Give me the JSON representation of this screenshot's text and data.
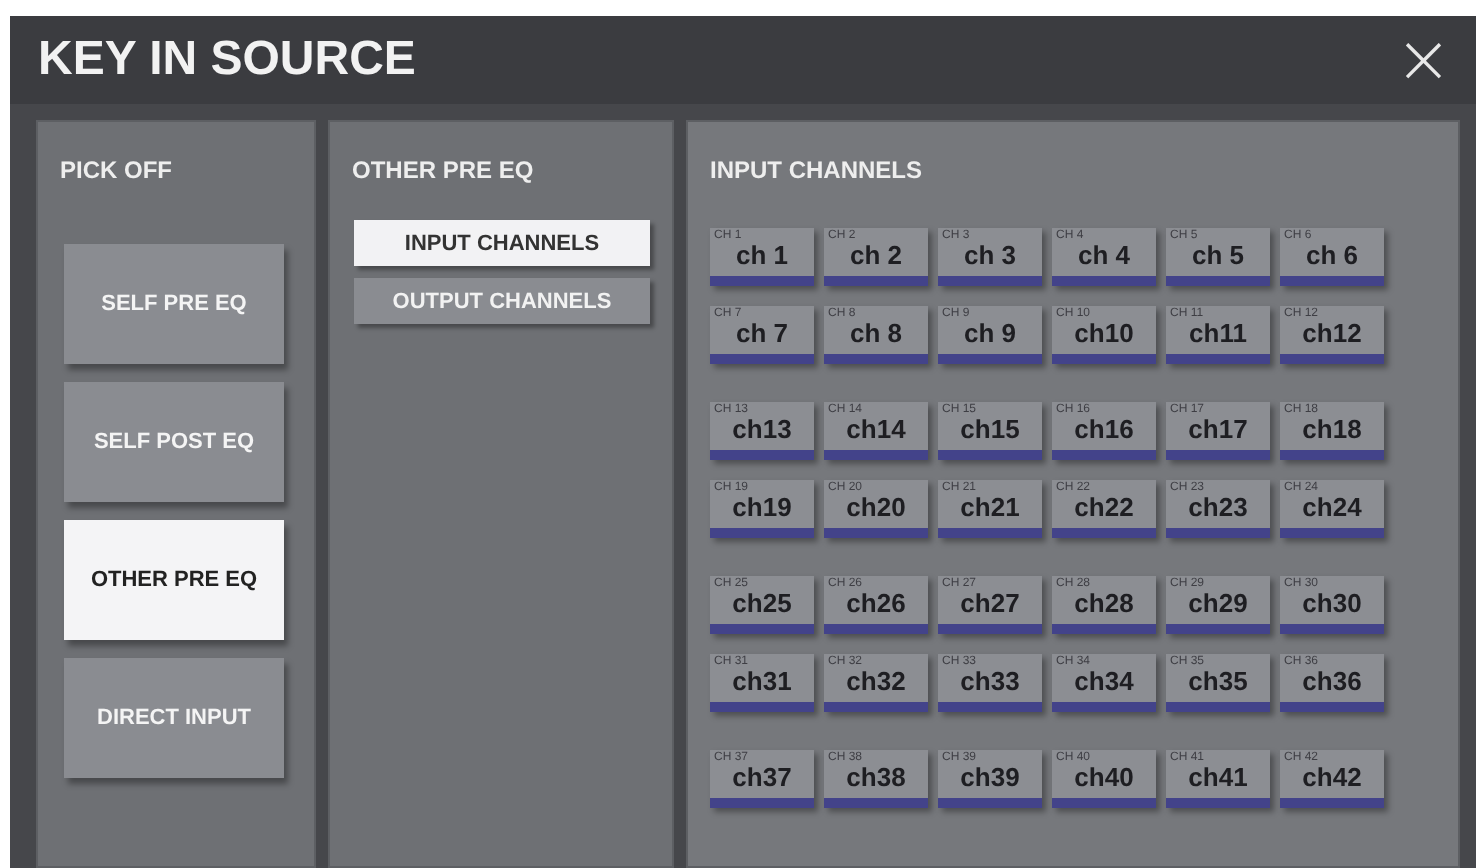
{
  "window": {
    "title": "KEY IN SOURCE",
    "close": "×"
  },
  "pick_off": {
    "title": "PICK OFF",
    "options": [
      {
        "label": "SELF PRE EQ",
        "selected": false
      },
      {
        "label": "SELF POST EQ",
        "selected": false
      },
      {
        "label": "OTHER PRE EQ",
        "selected": true
      },
      {
        "label": "DIRECT INPUT",
        "selected": false
      }
    ]
  },
  "source_type": {
    "title": "OTHER PRE EQ",
    "options": [
      {
        "label": "INPUT CHANNELS",
        "selected": true
      },
      {
        "label": "OUTPUT CHANNELS",
        "selected": false
      }
    ]
  },
  "channels_panel": {
    "title": "INPUT CHANNELS",
    "channels": [
      {
        "number": "CH 1",
        "name": "ch 1"
      },
      {
        "number": "CH 2",
        "name": "ch 2"
      },
      {
        "number": "CH 3",
        "name": "ch 3"
      },
      {
        "number": "CH 4",
        "name": "ch 4"
      },
      {
        "number": "CH 5",
        "name": "ch 5"
      },
      {
        "number": "CH 6",
        "name": "ch 6"
      },
      {
        "number": "CH 7",
        "name": "ch 7"
      },
      {
        "number": "CH 8",
        "name": "ch 8"
      },
      {
        "number": "CH 9",
        "name": "ch 9"
      },
      {
        "number": "CH 10",
        "name": "ch10"
      },
      {
        "number": "CH 11",
        "name": "ch11"
      },
      {
        "number": "CH 12",
        "name": "ch12"
      },
      {
        "number": "CH 13",
        "name": "ch13"
      },
      {
        "number": "CH 14",
        "name": "ch14"
      },
      {
        "number": "CH 15",
        "name": "ch15"
      },
      {
        "number": "CH 16",
        "name": "ch16"
      },
      {
        "number": "CH 17",
        "name": "ch17"
      },
      {
        "number": "CH 18",
        "name": "ch18"
      },
      {
        "number": "CH 19",
        "name": "ch19"
      },
      {
        "number": "CH 20",
        "name": "ch20"
      },
      {
        "number": "CH 21",
        "name": "ch21"
      },
      {
        "number": "CH 22",
        "name": "ch22"
      },
      {
        "number": "CH 23",
        "name": "ch23"
      },
      {
        "number": "CH 24",
        "name": "ch24"
      },
      {
        "number": "CH 25",
        "name": "ch25"
      },
      {
        "number": "CH 26",
        "name": "ch26"
      },
      {
        "number": "CH 27",
        "name": "ch27"
      },
      {
        "number": "CH 28",
        "name": "ch28"
      },
      {
        "number": "CH 29",
        "name": "ch29"
      },
      {
        "number": "CH 30",
        "name": "ch30"
      },
      {
        "number": "CH 31",
        "name": "ch31"
      },
      {
        "number": "CH 32",
        "name": "ch32"
      },
      {
        "number": "CH 33",
        "name": "ch33"
      },
      {
        "number": "CH 34",
        "name": "ch34"
      },
      {
        "number": "CH 35",
        "name": "ch35"
      },
      {
        "number": "CH 36",
        "name": "ch36"
      },
      {
        "number": "CH 37",
        "name": "ch37"
      },
      {
        "number": "CH 38",
        "name": "ch38"
      },
      {
        "number": "CH 39",
        "name": "ch39"
      },
      {
        "number": "CH 40",
        "name": "ch40"
      },
      {
        "number": "CH 41",
        "name": "ch41"
      },
      {
        "number": "CH 42",
        "name": "ch42"
      }
    ]
  }
}
